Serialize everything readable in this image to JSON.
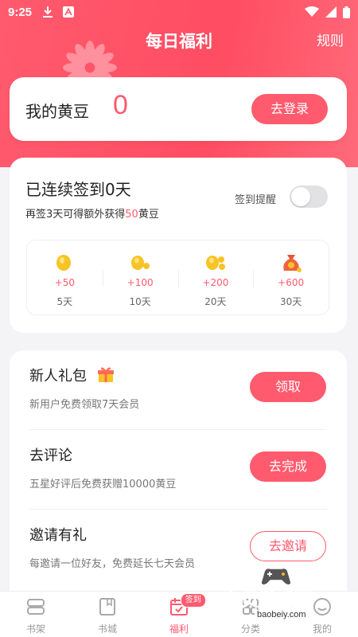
{
  "status_bar": {
    "time": "9:25",
    "icons": [
      "download-icon",
      "font-icon",
      "wifi-icon",
      "signal-icon",
      "battery-icon"
    ]
  },
  "header": {
    "title": "每日福利",
    "rules_label": "规则"
  },
  "beans": {
    "label": "我的黄豆",
    "count": "0",
    "login_label": "去登录"
  },
  "sign_in": {
    "title": "已连续签到0天",
    "subtitle_prefix": "再签3天可得额外获得",
    "subtitle_highlight": "50",
    "subtitle_suffix": "黄豆",
    "reminder_label": "签到提醒",
    "reminder_on": false,
    "rewards": [
      {
        "points": "+50",
        "days": "5天",
        "icon": "coin-icon"
      },
      {
        "points": "+100",
        "days": "10天",
        "icon": "coins-icon"
      },
      {
        "points": "+200",
        "days": "20天",
        "icon": "coin-stack-icon"
      },
      {
        "points": "+600",
        "days": "30天",
        "icon": "money-bag-icon"
      }
    ]
  },
  "tasks": [
    {
      "title": "新人礼包",
      "desc": "新用户免费领取7天会员",
      "button": "领取",
      "style": "filled",
      "icon": "gift-icon"
    },
    {
      "title": "去评论",
      "desc": "五星好评后免费获赠10000黄豆",
      "button": "去完成",
      "style": "filled"
    },
    {
      "title": "邀请有礼",
      "desc": "每邀请一位好友，免费延长七天会员",
      "button": "去邀请",
      "style": "outline"
    }
  ],
  "tabbar": {
    "tabs": [
      {
        "label": "书架",
        "icon": "bookshelf-icon"
      },
      {
        "label": "书城",
        "icon": "bookstore-icon"
      },
      {
        "label": "福利",
        "icon": "calendar-icon",
        "badge": "签到",
        "active": true
      },
      {
        "label": "分类",
        "icon": "category-icon"
      },
      {
        "label": "我的",
        "icon": "profile-icon"
      }
    ]
  },
  "watermark": {
    "text": "宝贝游戏网",
    "url": "baobeiy.com"
  },
  "colors": {
    "accent": "#ff5a6e",
    "background": "#f4f4f6"
  }
}
